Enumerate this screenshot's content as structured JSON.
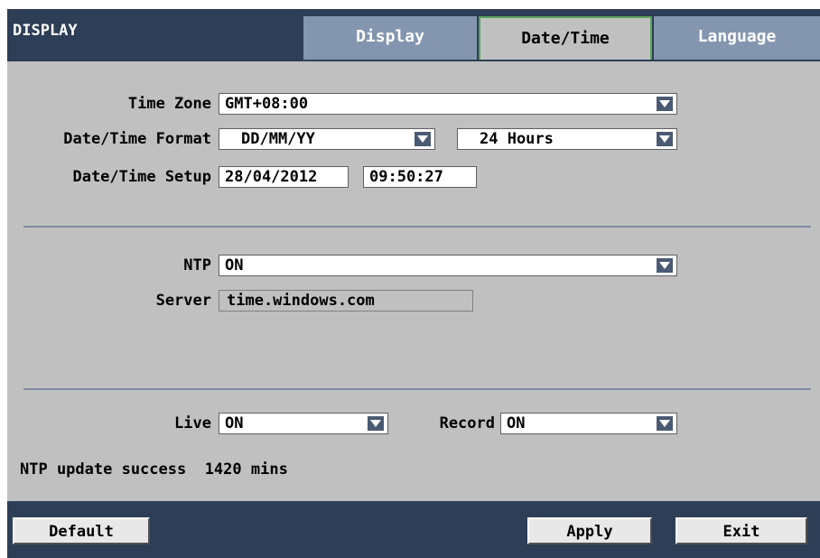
{
  "window": {
    "title": "DISPLAY"
  },
  "tabs": [
    {
      "label": "Display"
    },
    {
      "label": "Date/Time",
      "active": true
    },
    {
      "label": "Language"
    }
  ],
  "form": {
    "time_zone": {
      "label": "Time Zone",
      "value": "GMT+08:00"
    },
    "format": {
      "label": "Date/Time Format",
      "date_value": "DD/MM/YY",
      "time_value": "24 Hours"
    },
    "setup": {
      "label": "Date/Time Setup",
      "date": "28/04/2012",
      "time": "09:50:27"
    },
    "ntp": {
      "label": "NTP",
      "value": "ON"
    },
    "server": {
      "label": "Server",
      "value": "time.windows.com"
    },
    "live": {
      "label": "Live",
      "value": "ON"
    },
    "record": {
      "label": "Record",
      "value": "ON"
    }
  },
  "status": {
    "text": "NTP update success  1420 mins"
  },
  "buttons": {
    "default": "Default",
    "apply": "Apply",
    "exit": "Exit"
  },
  "colors": {
    "header_bg": "#2d3e56",
    "panel_bg": "#c0c0c0",
    "tab_inactive": "#8496af",
    "tab_active_border": "#5aa25a",
    "dropdown_arrow": "#4a5a72"
  },
  "icons": {
    "dropdown": "chevron-down-icon"
  }
}
